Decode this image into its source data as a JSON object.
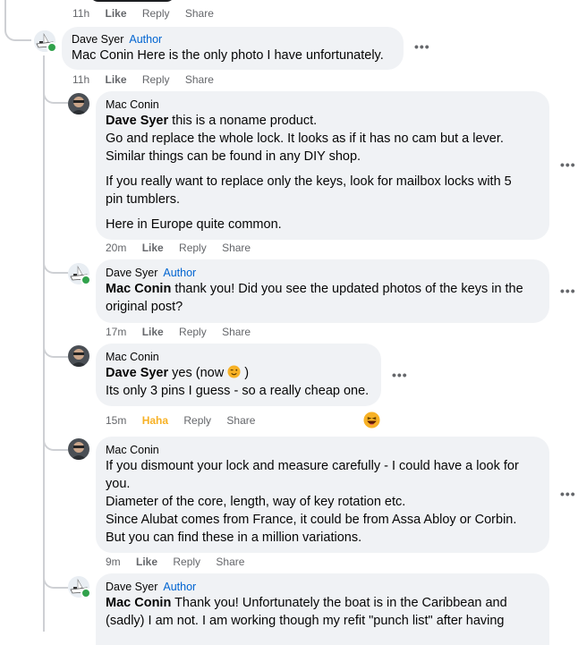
{
  "top": {
    "time": "11h",
    "like": "Like",
    "reply": "Reply",
    "share": "Share"
  },
  "comments": [
    {
      "author": "Dave Syer",
      "badge": "Author",
      "mention": "",
      "lines": [
        "Mac Conin Here is the only photo I have unfortunately."
      ],
      "time": "11h",
      "like": "Like",
      "reply": "Reply",
      "share": "Share"
    },
    {
      "author": "Mac Conin",
      "mention": "Dave Syer",
      "lines": [
        " this is a noname product.",
        "Go and replace the whole lock. It looks as if it has no cam but a lever.",
        "Similar things can be found in any DIY shop.",
        "If you really want to replace only the keys, look for mailbox locks with 5",
        "pin tumblers.",
        "Here in Europe quite common."
      ],
      "time": "20m",
      "like": "Like",
      "reply": "Reply",
      "share": "Share"
    },
    {
      "author": "Dave Syer",
      "badge": "Author",
      "mention": "Mac Conin",
      "lines": [
        " thank you! Did you see the updated photos of the keys in the",
        "original post?"
      ],
      "time": "17m",
      "like": "Like",
      "reply": "Reply",
      "share": "Share"
    },
    {
      "author": "Mac Conin",
      "mention": "Dave Syer",
      "lines": [
        " yes (now ",
        " )",
        "Its only 3 pins I guess - so a really cheap one."
      ],
      "time": "15m",
      "like": "Haha",
      "reply": "Reply",
      "share": "Share"
    },
    {
      "author": "Mac Conin",
      "mention": "",
      "lines": [
        "If you dismount your lock and measure carefully - I could have a look for",
        "you.",
        "Diameter of the core, length, way of key rotation etc.",
        "Since Alubat comes from France, it could be from Assa Abloy or Corbin.",
        "But you can find these in a million variations."
      ],
      "time": "9m",
      "like": "Like",
      "reply": "Reply",
      "share": "Share"
    },
    {
      "author": "Dave Syer",
      "badge": "Author",
      "mention": "Mac Conin",
      "lines": [
        " Thank you! Unfortunately the boat is in the Caribbean and",
        "(sadly) I am not. I am working though my refit \"punch list\" after having"
      ]
    }
  ]
}
